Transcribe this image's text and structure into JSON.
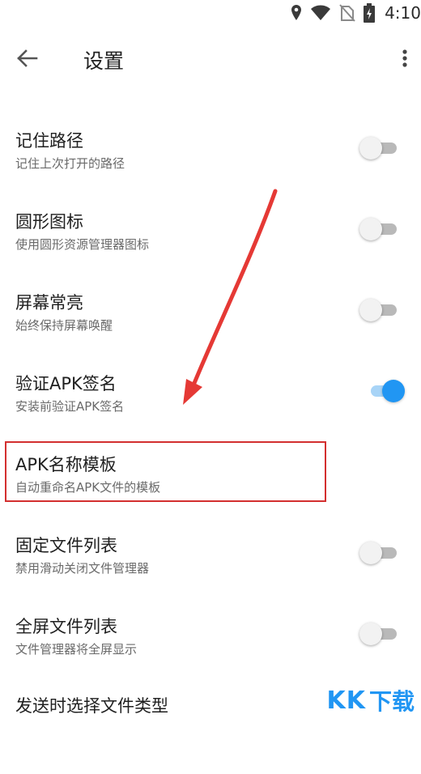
{
  "status_bar": {
    "time": "4:10"
  },
  "app_bar": {
    "title": "设置"
  },
  "settings": [
    {
      "title": "记住路径",
      "summary": "记住上次打开的路径",
      "toggle": "off"
    },
    {
      "title": "圆形图标",
      "summary": "使用圆形资源管理器图标",
      "toggle": "off"
    },
    {
      "title": "屏幕常亮",
      "summary": "始终保持屏幕唤醒",
      "toggle": "off"
    },
    {
      "title": "验证APK签名",
      "summary": "安装前验证APK签名",
      "toggle": "on"
    },
    {
      "title": "APK名称模板",
      "summary": "自动重命名APK文件的模板",
      "toggle": null
    },
    {
      "title": "固定文件列表",
      "summary": "禁用滑动关闭文件管理器",
      "toggle": "off"
    },
    {
      "title": "全屏文件列表",
      "summary": "文件管理器将全屏显示",
      "toggle": "off"
    },
    {
      "title": "发送时选择文件类型",
      "summary": "",
      "toggle": "on"
    }
  ],
  "watermark": {
    "kk": "KK",
    "label": "下载"
  },
  "colors": {
    "accent": "#2196f3",
    "highlight": "#d32f2f"
  }
}
